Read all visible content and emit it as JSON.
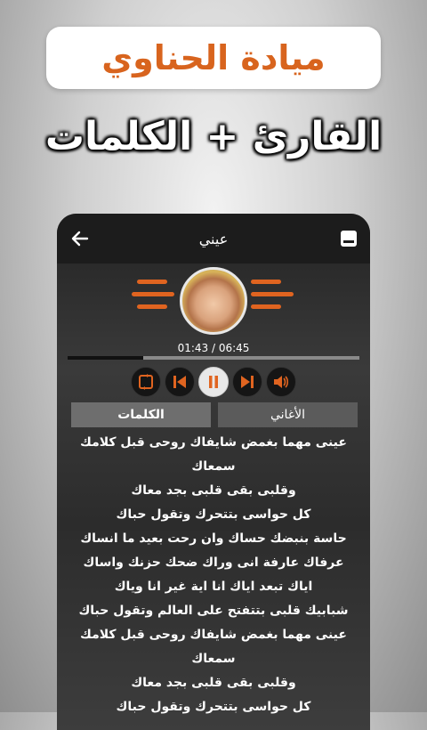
{
  "banner": {
    "title": "ميادة الحناوي"
  },
  "subtitle": "القارئ + الكلمات",
  "app": {
    "header": {
      "title": "عيني"
    },
    "player": {
      "time": "01:43 / 06:45",
      "progress": 0.26
    },
    "tabs": [
      {
        "label": "الكلمات",
        "active": true
      },
      {
        "label": "الأغاني",
        "active": false
      }
    ],
    "lyrics": [
      "عينى مهما بغمض شايفاك روحى قبل كلامك",
      "سمعاك",
      "وقلبى بقى قلبى بجد معاك",
      "كل حواسى بتتحرك وتقول حباك",
      "حاسة بنبضك حساك وان رحت بعيد ما انساك",
      "عرفاك عارفة انى وراك ضحك حزنك واساك",
      "اياك تبعد اياك انا اية غير انا وياك",
      "شبابيك قلبى بتتفتح على العالم وتقول حباك",
      "عينى مهما بغمض شايفاك روحى قبل كلامك",
      "سمعاك",
      "وقلبى بقى قلبى بجد معاك",
      "كل حواسى بتتحرك وتقول حباك"
    ]
  },
  "colors": {
    "accent": "#d8641e",
    "bars": "#e06420"
  },
  "icons": [
    "back-arrow-icon",
    "menu-icon",
    "repeat-icon",
    "previous-icon",
    "pause-icon",
    "next-icon",
    "volume-icon"
  ]
}
